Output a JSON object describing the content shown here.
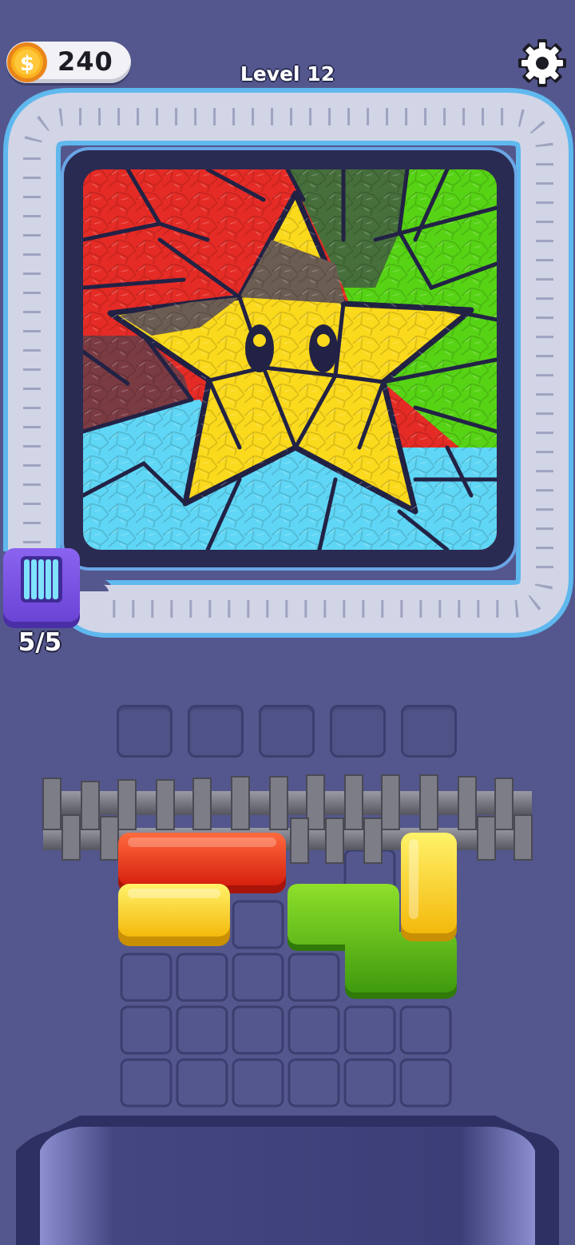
{
  "hud": {
    "coins": "240",
    "level_label": "Level 12",
    "coin_icon": "dollar-coin-icon",
    "settings_icon": "gear-icon"
  },
  "spool": {
    "count_label": "5/5",
    "icon": "thread-spool-icon"
  },
  "colors": {
    "background": "#54578d",
    "red": "#e52b25",
    "yellow": "#fbd91c",
    "green": "#56d315",
    "cyan": "#5fd6f5",
    "frame": "#c6cbe0"
  },
  "slots_count": 5,
  "blocks": [
    {
      "color": "red",
      "shape": "bar-3"
    },
    {
      "color": "yellow",
      "shape": "bar-2"
    },
    {
      "color": "green",
      "shape": "s-tetromino"
    },
    {
      "color": "yellow",
      "shape": "vertical-bar-2"
    }
  ]
}
